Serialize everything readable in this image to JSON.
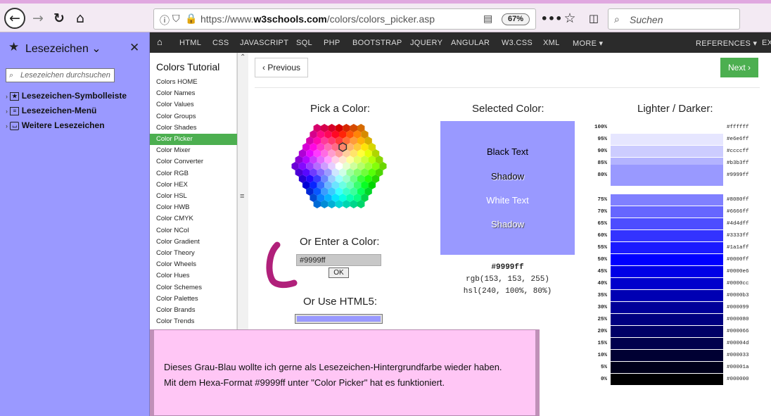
{
  "browser": {
    "url_prefix": "https://www.",
    "url_host": "w3schools.com",
    "url_path": "/colors/colors_picker.asp",
    "zoom": "67%",
    "search_placeholder": "Suchen"
  },
  "sidebar": {
    "title": "Lesezeichen",
    "search_placeholder": "Lesezeichen durchsuchen",
    "items": [
      {
        "label": "Lesezeichen-Symbolleiste"
      },
      {
        "label": "Lesezeichen-Menü"
      },
      {
        "label": "Weitere Lesezeichen"
      }
    ]
  },
  "w3nav": {
    "items": [
      "HTML",
      "CSS",
      "JAVASCRIPT",
      "SQL",
      "PHP",
      "BOOTSTRAP",
      "JQUERY",
      "ANGULAR",
      "W3.CSS",
      "XML",
      "MORE ▾"
    ],
    "references": "REFERENCES ▾",
    "ex": "EX"
  },
  "tutorial": {
    "title": "Colors Tutorial",
    "items": [
      "Colors HOME",
      "Color Names",
      "Color Values",
      "Color Groups",
      "Color Shades",
      "Color Picker",
      "Color Mixer",
      "Color Converter",
      "Color RGB",
      "Color HEX",
      "Color HSL",
      "Color HWB",
      "Color CMYK",
      "Color NCol",
      "Color Gradient",
      "Color Theory",
      "Color Wheels",
      "Color Hues",
      "Color Schemes",
      "Color Palettes",
      "Color Brands",
      "Color Trends"
    ],
    "active_index": 5
  },
  "main": {
    "prev_label": "Previous",
    "next_label": "Next",
    "pick_heading": "Pick a Color:",
    "enter_heading": "Or Enter a Color:",
    "input_value": "#9999ff",
    "ok_label": "OK",
    "html5_heading": "Or Use HTML5:",
    "selected_heading": "Selected Color:",
    "selected_color": "#9999ff",
    "selected_texts": {
      "black": "Black Text",
      "shadow1": "Shadow",
      "white": "White Text",
      "shadow2": "Shadow"
    },
    "hex": "#9999ff",
    "rgb": "rgb(153, 153, 255)",
    "hsl": "hsl(240, 100%, 80%)",
    "ld_heading": "Lighter / Darker:",
    "shades": [
      {
        "pct": "100%",
        "hex": "#ffffff"
      },
      {
        "pct": "95%",
        "hex": "#e6e6ff"
      },
      {
        "pct": "90%",
        "hex": "#ccccff"
      },
      {
        "pct": "85%",
        "hex": "#b3b3ff"
      },
      {
        "pct": "80%",
        "hex": "#9999ff"
      },
      {
        "pct": "75%",
        "hex": "#8080ff"
      },
      {
        "pct": "70%",
        "hex": "#6666ff"
      },
      {
        "pct": "65%",
        "hex": "#4d4dff"
      },
      {
        "pct": "60%",
        "hex": "#3333ff"
      },
      {
        "pct": "55%",
        "hex": "#1a1aff"
      },
      {
        "pct": "50%",
        "hex": "#0000ff"
      },
      {
        "pct": "45%",
        "hex": "#0000e6"
      },
      {
        "pct": "40%",
        "hex": "#0000cc"
      },
      {
        "pct": "35%",
        "hex": "#0000b3"
      },
      {
        "pct": "30%",
        "hex": "#000099"
      },
      {
        "pct": "25%",
        "hex": "#000080"
      },
      {
        "pct": "20%",
        "hex": "#000066"
      },
      {
        "pct": "15%",
        "hex": "#00004d"
      },
      {
        "pct": "10%",
        "hex": "#000033"
      },
      {
        "pct": "5%",
        "hex": "#00001a"
      },
      {
        "pct": "0%",
        "hex": "#000000"
      }
    ]
  },
  "note": {
    "line1": "Dieses Grau-Blau wollte ich gerne als Lesezeichen-Hintergrundfarbe wieder haben.",
    "line2": "Mit  dem Hexa-Format #9999ff unter  \"Color Picker\" hat es funktioniert."
  }
}
